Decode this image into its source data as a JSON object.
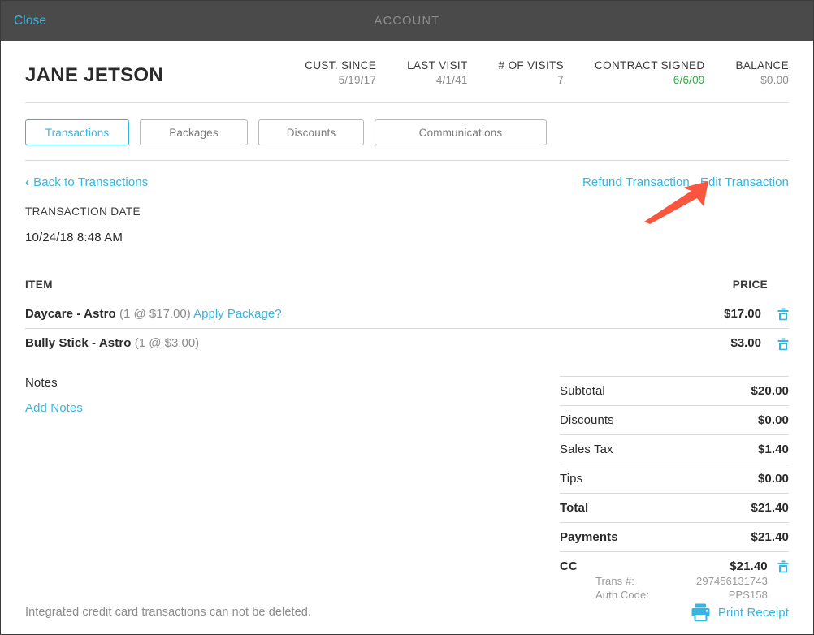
{
  "titlebar": {
    "close_label": "Close",
    "title": "ACCOUNT"
  },
  "customer": {
    "name": "JANE JETSON",
    "stats": [
      {
        "label": "CUST. SINCE",
        "value": "5/19/17",
        "color": "#8c8c8c"
      },
      {
        "label": "LAST VISIT",
        "value": "4/1/41",
        "color": "#8c8c8c"
      },
      {
        "label": "# OF VISITS",
        "value": "7",
        "color": "#8c8c8c"
      },
      {
        "label": "CONTRACT SIGNED",
        "value": "6/6/09",
        "color": "#37a84a"
      },
      {
        "label": "BALANCE",
        "value": "$0.00",
        "color": "#8c8c8c"
      }
    ]
  },
  "tabs": [
    {
      "label": "Transactions",
      "active": true
    },
    {
      "label": "Packages",
      "active": false
    },
    {
      "label": "Discounts",
      "active": false
    },
    {
      "label": "Communications",
      "active": false
    }
  ],
  "actions": {
    "back_label": "Back to Transactions",
    "back_chevron": "‹",
    "refund_label": "Refund Transaction",
    "edit_label": "Edit Transaction"
  },
  "transaction": {
    "date_label": "TRANSACTION DATE",
    "date_value": "10/24/18 8:48 AM"
  },
  "items_table": {
    "header_item": "ITEM",
    "header_price": "PRICE",
    "rows": [
      {
        "name": "Daycare - Astro",
        "qty": "(1 @ $17.00)",
        "apply_package": "Apply Package?",
        "price": "$17.00",
        "indent": false
      },
      {
        "name": "Bully Stick - Astro",
        "qty": "(1 @ $3.00)",
        "apply_package": "",
        "price": "$3.00",
        "indent": true
      }
    ]
  },
  "notes": {
    "title": "Notes",
    "add_label": "Add Notes"
  },
  "totals": [
    {
      "label": "Subtotal",
      "amount": "$20.00",
      "bold": false
    },
    {
      "label": "Discounts",
      "amount": "$0.00",
      "bold": false
    },
    {
      "label": "Sales Tax",
      "amount": "$1.40",
      "bold": false
    },
    {
      "label": "Tips",
      "amount": "$0.00",
      "bold": false
    },
    {
      "label": "Total",
      "amount": "$21.40",
      "bold": true
    },
    {
      "label": "Payments",
      "amount": "$21.40",
      "bold": true
    }
  ],
  "payment": {
    "method": "CC",
    "amount": "$21.40",
    "trans_label": "Trans #:",
    "trans_value": "297456131743",
    "auth_label": "Auth Code:",
    "auth_value": "PPS158"
  },
  "footer": {
    "note": "Integrated credit card transactions can not be deleted.",
    "print_label": "Print Receipt"
  },
  "icons": {
    "trash": "trash-icon",
    "printer": "printer-icon",
    "annotation_arrow": "red-arrow-annotation"
  },
  "colors": {
    "accent": "#36b5e0",
    "titlebar_bg": "#4a4a4a",
    "green": "#37a84a",
    "muted": "#8c8c8c",
    "annotation_red": "#f9553f"
  }
}
